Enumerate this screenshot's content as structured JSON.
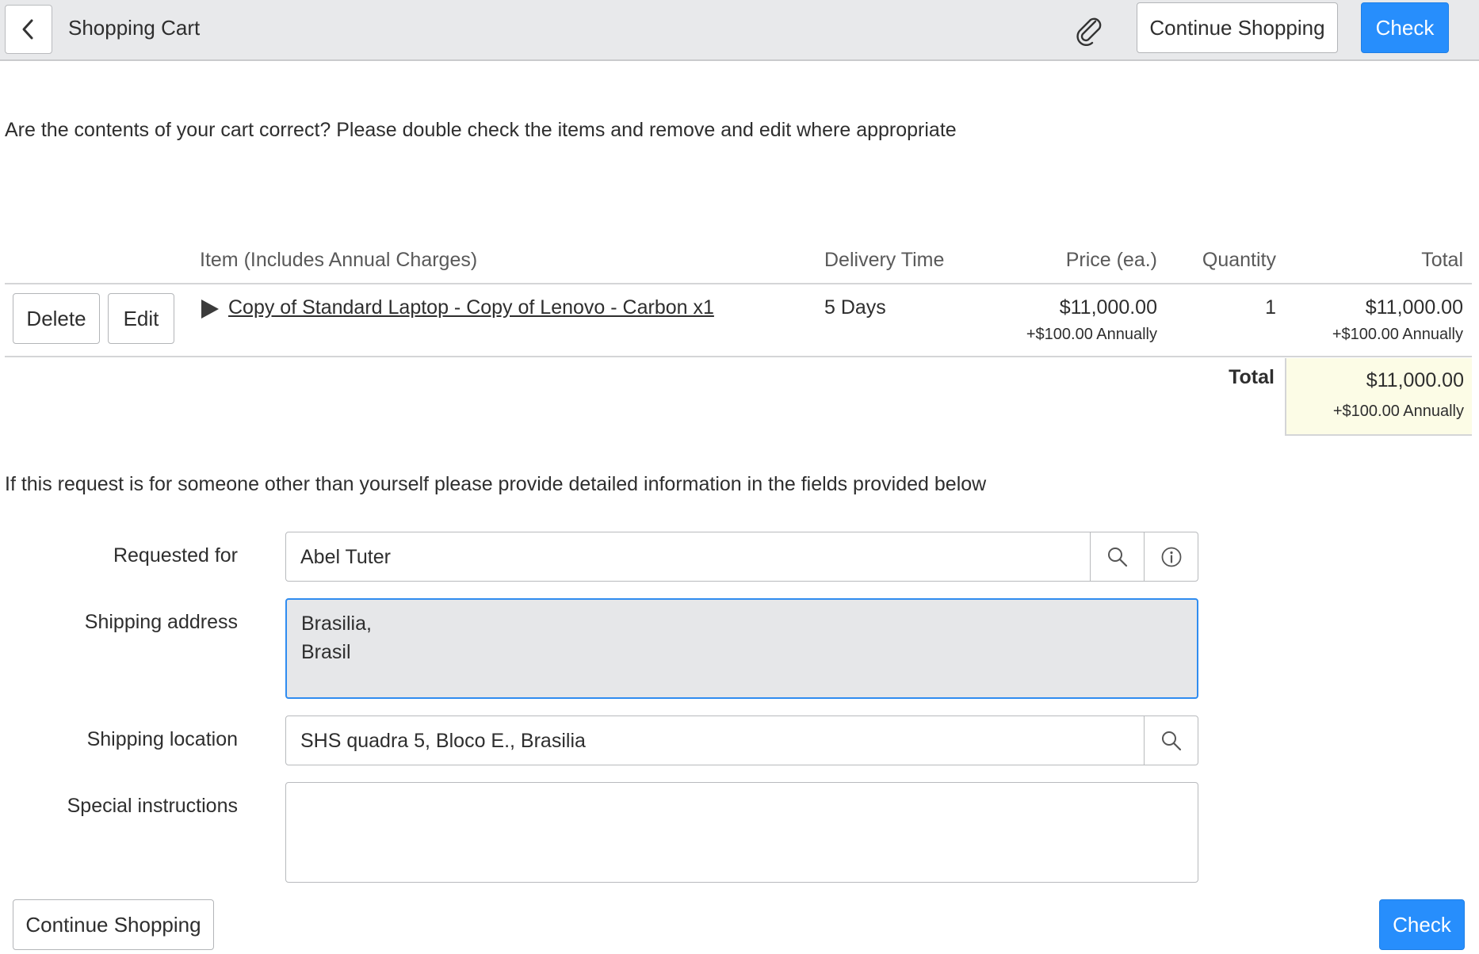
{
  "header": {
    "title": "Shopping Cart",
    "continue_label": "Continue Shopping",
    "check_label": "Check"
  },
  "intro": "Are the contents of your cart correct? Please double check the items and remove and edit where appropriate",
  "table": {
    "headers": {
      "item": "Item (Includes Annual Charges)",
      "delivery": "Delivery Time",
      "price": "Price (ea.)",
      "quantity": "Quantity",
      "total": "Total"
    },
    "rows": [
      {
        "delete_label": "Delete",
        "edit_label": "Edit",
        "item": "Copy of Standard Laptop - Copy of Lenovo - Carbon x1",
        "delivery": "5 Days",
        "price": "$11,000.00",
        "price_annual": "+$100.00 Annually",
        "quantity": "1",
        "total": "$11,000.00",
        "total_annual": "+$100.00 Annually"
      }
    ],
    "grand_total_label": "Total",
    "grand_total": "$11,000.00",
    "grand_total_annual": "+$100.00 Annually"
  },
  "note": "If this request is for someone other than yourself please provide detailed information in the fields provided below",
  "form": {
    "requested_for": {
      "label": "Requested for",
      "value": "Abel Tuter"
    },
    "shipping_address": {
      "label": "Shipping address",
      "line1": "Brasilia,",
      "line2": "Brasil"
    },
    "shipping_location": {
      "label": "Shipping location",
      "value": "SHS quadra 5, Bloco E., Brasilia"
    },
    "special_instructions": {
      "label": "Special instructions",
      "value": ""
    }
  },
  "footer": {
    "continue_label": "Continue Shopping",
    "check_label": "Check"
  },
  "colors": {
    "primary": "#278efc",
    "header_bg": "#e8e9eb",
    "total_highlight": "#fcfce6",
    "focus_border": "#2f8cf0",
    "readonly_bg": "#e6e7e9"
  }
}
